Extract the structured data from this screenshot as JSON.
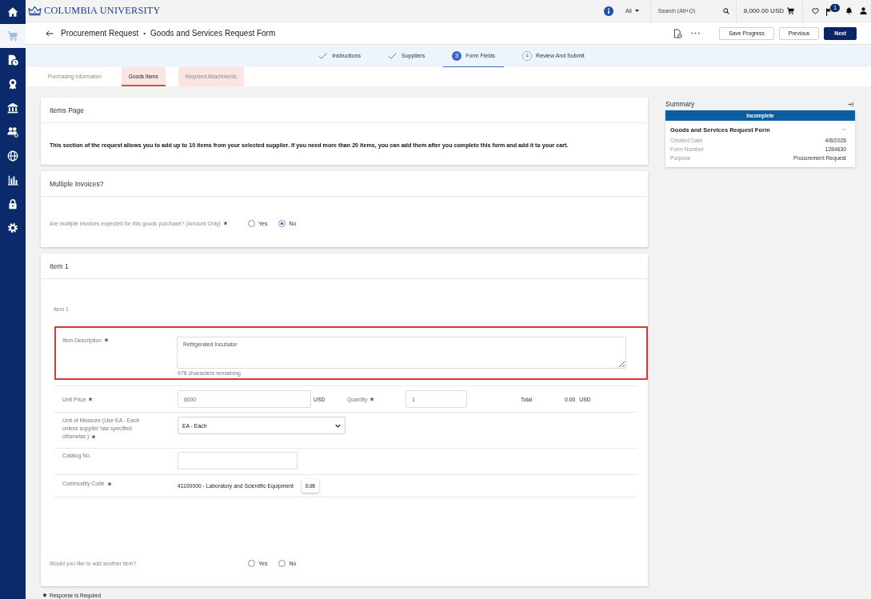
{
  "sidebar": {
    "items": [
      {
        "selected": false
      },
      {
        "selected": true
      },
      {
        "selected": false
      },
      {
        "selected": false
      },
      {
        "selected": false
      },
      {
        "selected": false
      },
      {
        "selected": false
      },
      {
        "selected": false
      },
      {
        "selected": false
      },
      {
        "selected": false
      }
    ]
  },
  "header": {
    "logo": "COLUMBIA UNIVERSITY",
    "scope": "All",
    "search": {
      "placeholder": "Search (Alt+Q)"
    },
    "cart_total": "8,000.00 USD",
    "notification_count": "1"
  },
  "title_bar": {
    "breadcrumb": "Procurement Request",
    "separator": "•",
    "title": "Goods and Services Request Form",
    "buttons": [
      {
        "label": "Save Progress",
        "kind": "secondary"
      },
      {
        "label": "Previous",
        "kind": "secondary"
      },
      {
        "label": "Next",
        "kind": "primary"
      }
    ]
  },
  "steps": [
    {
      "label": "Instructions",
      "kind": "done",
      "selected": false
    },
    {
      "label": "Suppliers",
      "kind": "done",
      "selected": false
    },
    {
      "label": "Form Fields",
      "number": "3",
      "kind": "current",
      "selected": true
    },
    {
      "label": "Review And Submit",
      "number": "4",
      "kind": "pending",
      "selected": false
    }
  ],
  "tabs": [
    {
      "label": "Purchasing Information",
      "selected": false,
      "flagged": false
    },
    {
      "label": "Goods Items",
      "selected": true,
      "flagged": true
    },
    {
      "label": "Required Attachments",
      "selected": false,
      "flagged": true
    }
  ],
  "items_page": {
    "title": "Items Page",
    "text": "This section of the request allows you to add up to 10 items from your selected supplier. If you need more than 20 items, you can add them after you complete this form and add it to your cart."
  },
  "multiple_invoices": {
    "title": "Multiple Invoices?",
    "question": "Are multiple invoices expected for this goods purchase? (Amount Only)",
    "required": true,
    "options": [
      {
        "label": "Yes",
        "selected": false
      },
      {
        "label": "No",
        "selected": true
      }
    ]
  },
  "item": {
    "title": "Item 1",
    "subtitle": "Item 1",
    "description": {
      "label": "Item Description",
      "required": true,
      "value": "Refrigerated Incubator",
      "hint": "978 characters remaining",
      "highlighted": true
    },
    "unit_price": {
      "label": "Unit Price",
      "required": true,
      "value": "6000",
      "currency": "USD"
    },
    "quantity": {
      "label": "Quantity",
      "required": true,
      "value": "1"
    },
    "total": {
      "label": "Total",
      "value": "0.00",
      "currency": "USD"
    },
    "unit_of_measure": {
      "label": "Unit of Measure (Use EA - Each unless supplier has specified otherwise.)",
      "required": true,
      "value": "EA - Each"
    },
    "catalog_no": {
      "label": "Catalog No.",
      "required": false
    },
    "commodity_code": {
      "label": "Commodity Code",
      "required": true,
      "value": "41100000 - Laboratory and Scientific Equipment",
      "button": "Edit"
    },
    "add_another": {
      "question": "Would you like to add another item?",
      "options": [
        {
          "label": "Yes",
          "selected": false
        },
        {
          "label": "No",
          "selected": false
        }
      ]
    }
  },
  "footer_note": {
    "text": "Response Is Required"
  },
  "summary": {
    "title": "Summary",
    "status": "Incomplete",
    "form_title": "Goods and Services Request Form",
    "rows": [
      {
        "label": "Created Date",
        "value": "4/8/2026"
      },
      {
        "label": "Form Number",
        "value": "1284630"
      },
      {
        "label": "Purpose",
        "value": "Procurement Request"
      }
    ]
  }
}
